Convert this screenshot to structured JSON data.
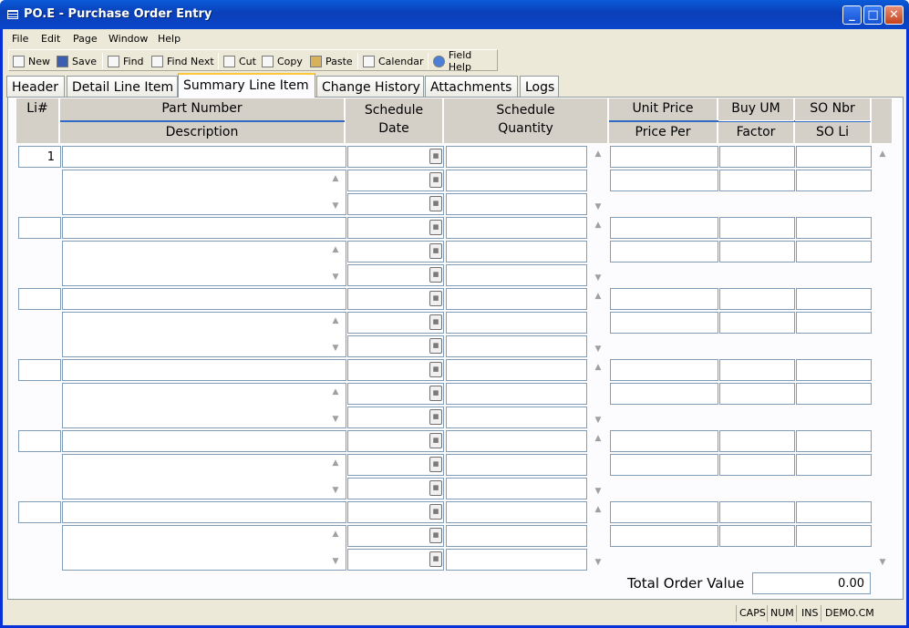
{
  "window": {
    "title": "PO.E - Purchase Order Entry"
  },
  "menu": [
    "File",
    "Edit",
    "Page",
    "Window",
    "Help"
  ],
  "toolbar": {
    "new": "New",
    "save": "Save",
    "find": "Find",
    "find_next": "Find Next",
    "cut": "Cut",
    "copy": "Copy",
    "paste": "Paste",
    "calendar": "Calendar",
    "field_help": "Field Help"
  },
  "tabs": [
    "Header",
    "Detail Line Item",
    "Summary Line Item",
    "Change History",
    "Attachments",
    "Logs"
  ],
  "active_tab": "Summary Line Item",
  "columns": {
    "li": "Li#",
    "part_number": "Part Number",
    "description": "Description",
    "schedule_date_1": "Schedule",
    "schedule_date_2": "Date",
    "schedule_qty_1": "Schedule",
    "schedule_qty_2": "Quantity",
    "unit_price": "Unit Price",
    "price_per": "Price Per",
    "buy_um": "Buy UM",
    "factor": "Factor",
    "so_nbr": "SO Nbr",
    "so_li": "SO Li"
  },
  "rows": [
    {
      "li": "1"
    },
    {
      "li": ""
    },
    {
      "li": ""
    },
    {
      "li": ""
    },
    {
      "li": ""
    },
    {
      "li": ""
    }
  ],
  "total": {
    "label": "Total Order Value",
    "value": "0.00"
  },
  "status": [
    "CAPS",
    "NUM",
    "INS",
    "DEMO.CM"
  ]
}
